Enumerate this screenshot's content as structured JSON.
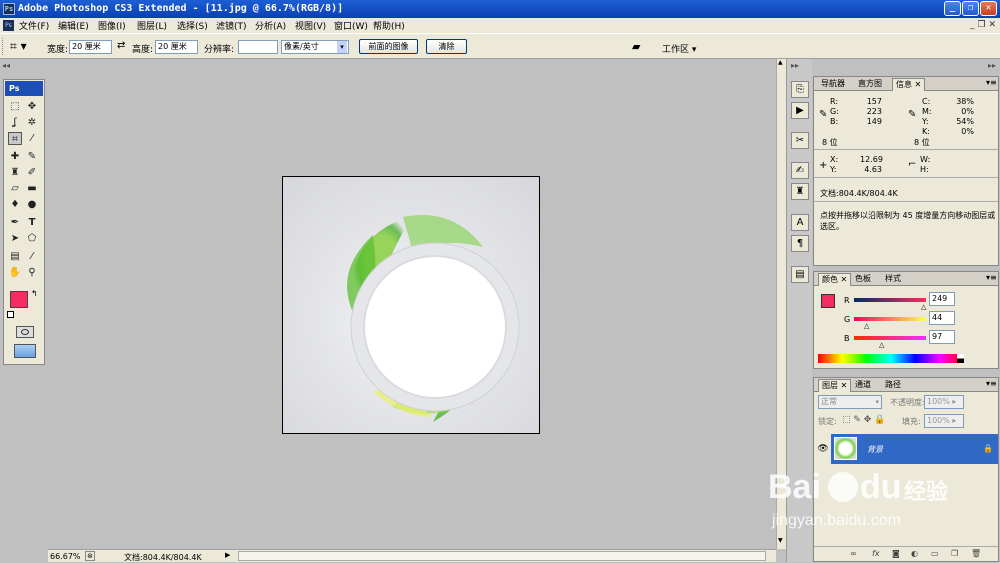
{
  "titlebar": {
    "title": "Adobe Photoshop CS3 Extended - [11.jpg @ 66.7%(RGB/8)]"
  },
  "menus": [
    "文件(F)",
    "编辑(E)",
    "图像(I)",
    "图层(L)",
    "选择(S)",
    "滤镜(T)",
    "分析(A)",
    "视图(V)",
    "窗口(W)",
    "帮助(H)"
  ],
  "options": {
    "width_label": "宽度:",
    "width_value": "20 厘米",
    "height_label": "高度:",
    "height_value": "20 厘米",
    "res_label": "分辨率:",
    "res_value": "",
    "res_unit": "像素/英寸",
    "front_btn": "前面的图像",
    "clear_btn": "清除",
    "workspace": "工作区"
  },
  "toolbox": {
    "header": "Ps"
  },
  "colors": {
    "foreground": "#f52c61",
    "background": "#fdf3a8"
  },
  "status": {
    "zoom": "66.67%",
    "doc": "文档:804.4K/804.4K"
  },
  "info_panel": {
    "tabs": [
      "导航器",
      "直方图",
      "信息"
    ],
    "r_label": "R:",
    "g_label": "G:",
    "b_label": "B:",
    "r": "157",
    "g": "223",
    "b": "149",
    "c_label": "C:",
    "m_label": "M:",
    "y_label": "Y:",
    "k_label": "K:",
    "c": "38%",
    "m": "0%",
    "y": "54%",
    "k": "0%",
    "bit_left": "8 位",
    "bit_right": "8 位",
    "x_label": "X:",
    "y2_label": "Y:",
    "x": "12.69",
    "y2": "4.63",
    "w_label": "W:",
    "h_label": "H:",
    "doc": "文档:804.4K/804.4K",
    "hint": "点按并拖移以沿限制为 45 度增量方向移动图层或选区。"
  },
  "color_panel": {
    "tabs": [
      "颜色",
      "色板",
      "样式"
    ],
    "r_label": "R",
    "g_label": "G",
    "b_label": "B",
    "r": "249",
    "g": "44",
    "b": "97"
  },
  "layers_panel": {
    "tabs": [
      "图层",
      "通道",
      "路径"
    ],
    "mode": "正常",
    "opacity_label": "不透明度:",
    "opacity": "100%",
    "lock_label": "锁定:",
    "fill_label": "填充:",
    "fill": "100%",
    "layer_name": "背景"
  },
  "watermark": {
    "text1": "Bai",
    "text2": "du",
    "text3": "经验",
    "url": "jingyan.baidu.com"
  }
}
